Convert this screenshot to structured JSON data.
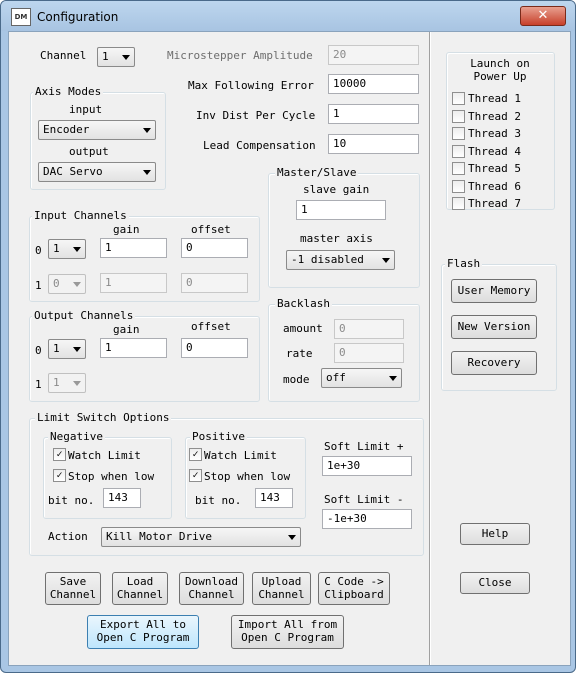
{
  "window": {
    "title": "Configuration",
    "close_glyph": "✕",
    "app_icon": "DM"
  },
  "channel": {
    "label": "Channel",
    "value": "1"
  },
  "microstepper": {
    "label": "Microstepper Amplitude",
    "value": "20"
  },
  "max_following_error": {
    "label": "Max Following Error",
    "value": "10000"
  },
  "inv_dist": {
    "label": "Inv Dist Per Cycle",
    "value": "1"
  },
  "lead_comp": {
    "label": "Lead Compensation",
    "value": "10"
  },
  "axis_modes": {
    "title": "Axis Modes",
    "input_label": "input",
    "input_value": "Encoder",
    "output_label": "output",
    "output_value": "DAC Servo"
  },
  "master_slave": {
    "title": "Master/Slave",
    "slave_gain_label": "slave gain",
    "slave_gain_value": "1",
    "master_axis_label": "master axis",
    "master_axis_value": "-1 disabled"
  },
  "input_channels": {
    "title": "Input Channels",
    "gain_label": "gain",
    "offset_label": "offset",
    "rows": [
      {
        "index": "0",
        "channel": "1",
        "gain": "1",
        "offset": "0"
      },
      {
        "index": "1",
        "channel": "0",
        "gain": "1",
        "offset": "0"
      }
    ]
  },
  "output_channels": {
    "title": "Output Channels",
    "gain_label": "gain",
    "offset_label": "offset",
    "rows": [
      {
        "index": "0",
        "channel": "1",
        "gain": "1",
        "offset": "0"
      },
      {
        "index": "1",
        "channel": "1"
      }
    ]
  },
  "backlash": {
    "title": "Backlash",
    "amount_label": "amount",
    "amount_value": "0",
    "rate_label": "rate",
    "rate_value": "0",
    "mode_label": "mode",
    "mode_value": "off"
  },
  "limit_switch": {
    "title": "Limit Switch Options",
    "negative": {
      "title": "Negative",
      "watch_limit": "Watch Limit",
      "stop_when_low": "Stop when low",
      "bit_label": "bit no.",
      "bit_value": "143",
      "check_glyph": "✓"
    },
    "positive": {
      "title": "Positive",
      "watch_limit": "Watch Limit",
      "stop_when_low": "Stop when low",
      "bit_label": "bit no.",
      "bit_value": "143",
      "check_glyph": "✓"
    },
    "soft_limit_plus_label": "Soft Limit +",
    "soft_limit_plus_value": "1e+30",
    "soft_limit_minus_label": "Soft Limit -",
    "soft_limit_minus_value": "-1e+30",
    "action_label": "Action",
    "action_value": "Kill Motor Drive"
  },
  "launch": {
    "title_line1": "Launch on",
    "title_line2": "Power Up",
    "threads": [
      "Thread 1",
      "Thread 2",
      "Thread 3",
      "Thread 4",
      "Thread 5",
      "Thread 6",
      "Thread 7"
    ]
  },
  "flash": {
    "title": "Flash",
    "user_memory": "User Memory",
    "new_version": "New Version",
    "recovery": "Recovery"
  },
  "buttons": {
    "save_line1": "Save",
    "save_line2": "Channel",
    "load_line1": "Load",
    "load_line2": "Channel",
    "download_line1": "Download",
    "download_line2": "Channel",
    "upload_line1": "Upload",
    "upload_line2": "Channel",
    "ccode_line1": "C Code ->",
    "ccode_line2": "Clipboard",
    "export_line1": "Export All to",
    "export_line2": "Open C Program",
    "import_line1": "Import All from",
    "import_line2": "Open C Program",
    "help": "Help",
    "close": "Close"
  }
}
